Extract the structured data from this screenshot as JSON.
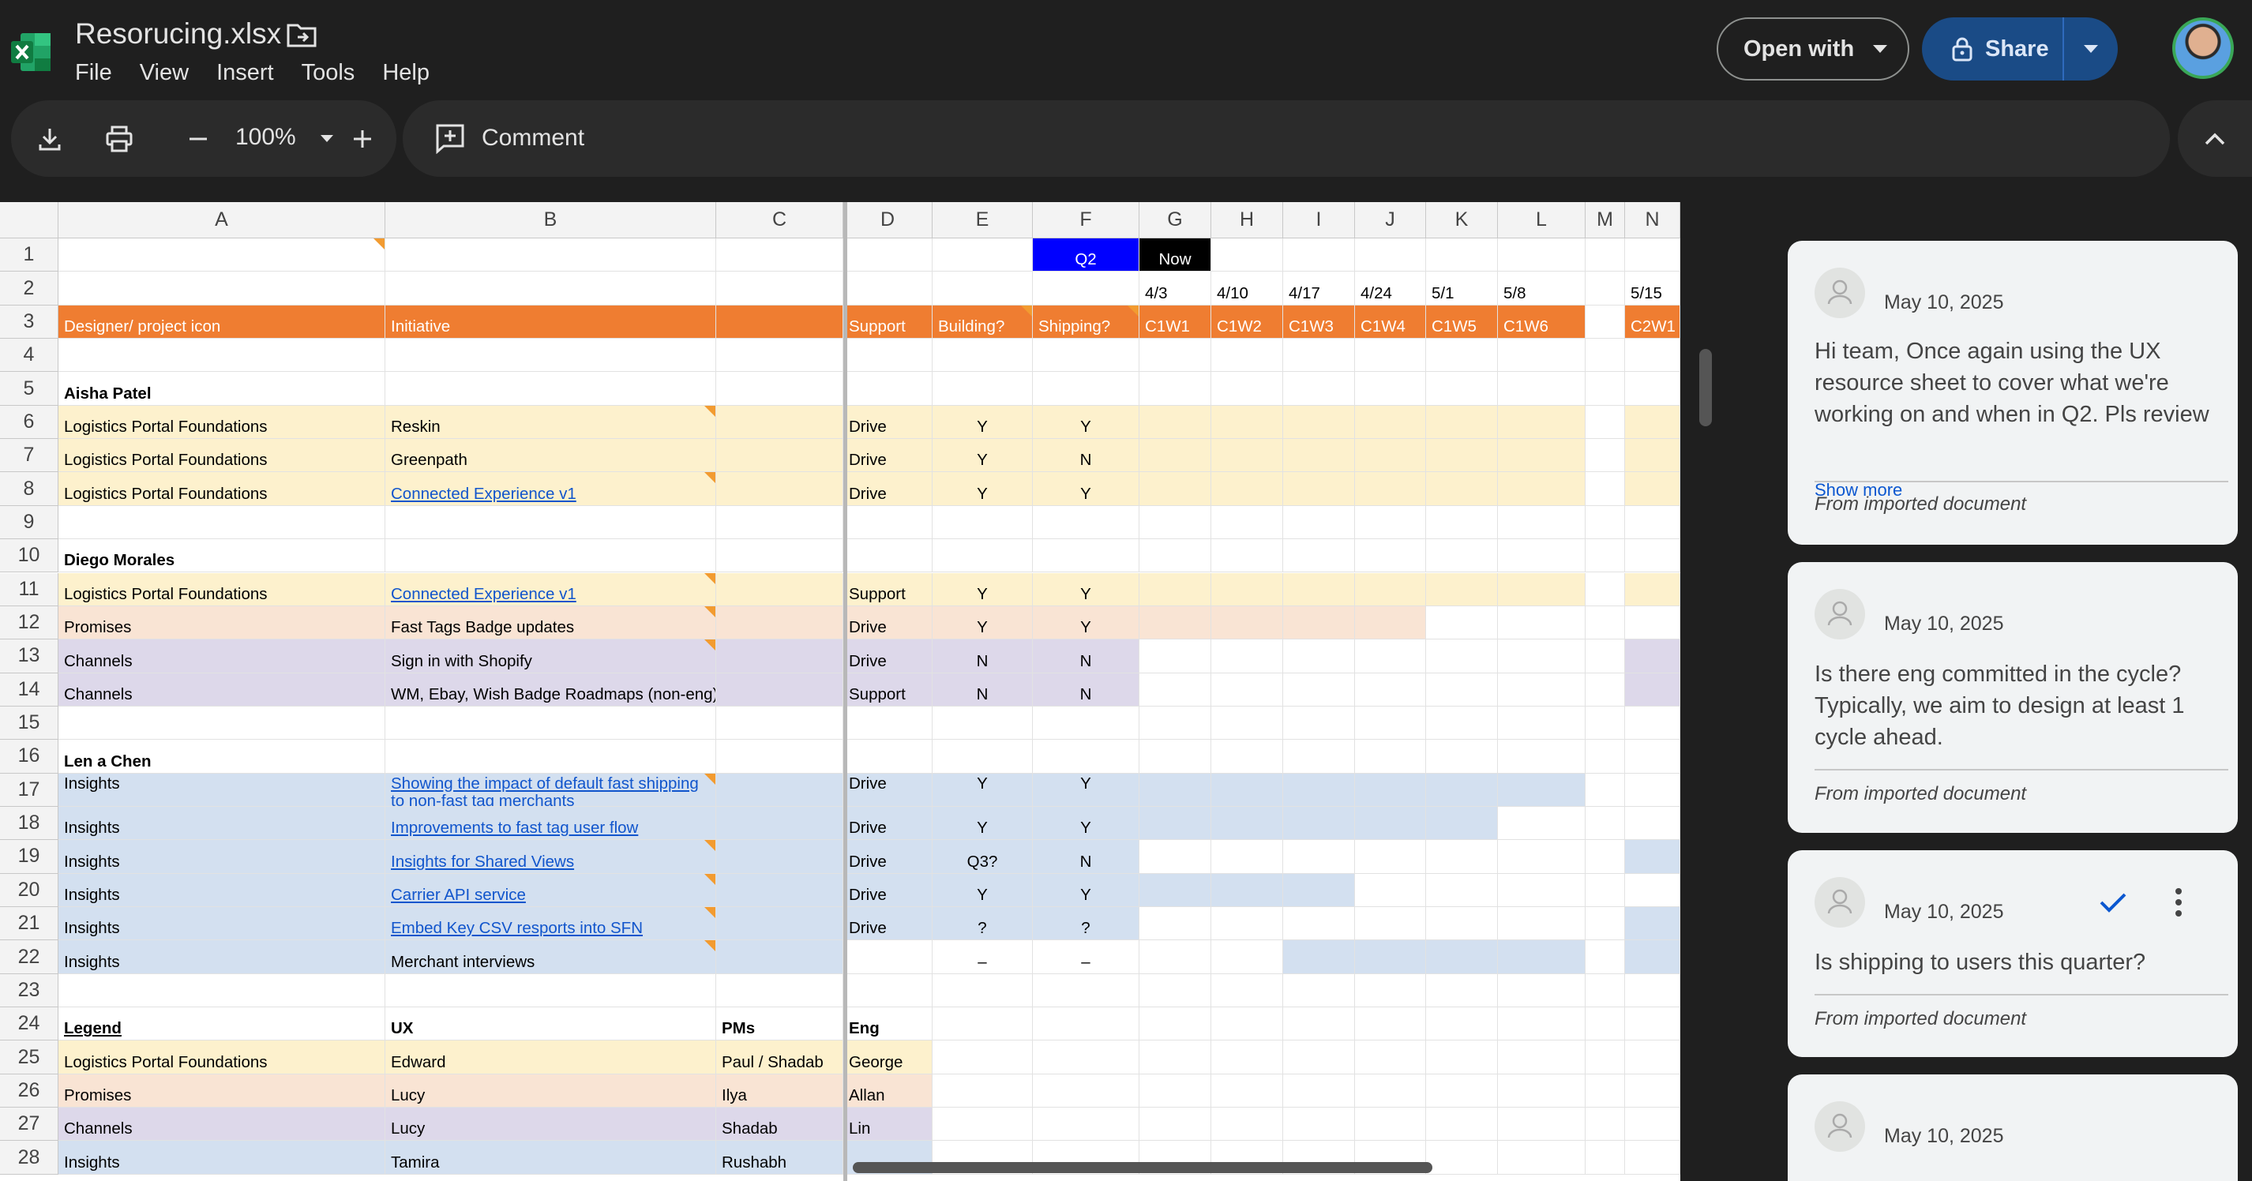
{
  "app": {
    "title": "Resorucing.xlsx",
    "menu": [
      "File",
      "View",
      "Insert",
      "Tools",
      "Help"
    ],
    "open_with_label": "Open with",
    "share_label": "Share"
  },
  "toolbar": {
    "zoom": "100%",
    "comment_label": "Comment"
  },
  "sheet": {
    "columns": [
      "A",
      "B",
      "C",
      "D",
      "E",
      "F",
      "G",
      "H",
      "I",
      "J",
      "K",
      "L",
      "M",
      "N"
    ],
    "rows": [
      {
        "n": 1,
        "cells": {
          "F": "Q2",
          "G": "Now"
        }
      },
      {
        "n": 2,
        "cells": {
          "G": "4/3",
          "H": "4/10",
          "I": "4/17",
          "J": "4/24",
          "K": "5/1",
          "L": "5/8",
          "N": "5/15"
        }
      },
      {
        "n": 3,
        "cells": {
          "A": "Designer/ project icon",
          "B": "Initiative",
          "D": "Support",
          "E": "Building?",
          "F": "Shipping?",
          "G": "C1W1",
          "H": "C1W2",
          "I": "C1W3",
          "J": "C1W4",
          "K": "C1W5",
          "L": "C1W6",
          "N": "C2W1"
        }
      },
      {
        "n": 4,
        "cells": {}
      },
      {
        "n": 5,
        "cells": {
          "A": "Aisha Patel"
        }
      },
      {
        "n": 6,
        "cells": {
          "A": "Logistics Portal Foundations",
          "B": "Reskin",
          "D": "Drive",
          "E": "Y",
          "F": "Y"
        }
      },
      {
        "n": 7,
        "cells": {
          "A": "Logistics Portal Foundations",
          "B": "Greenpath",
          "D": "Drive",
          "E": "Y",
          "F": "N"
        }
      },
      {
        "n": 8,
        "cells": {
          "A": "Logistics Portal Foundations",
          "B": "Connected Experience v1",
          "D": "Drive",
          "E": "Y",
          "F": "Y"
        }
      },
      {
        "n": 9,
        "cells": {}
      },
      {
        "n": 10,
        "cells": {
          "A": "Diego Morales"
        }
      },
      {
        "n": 11,
        "cells": {
          "A": "Logistics Portal Foundations",
          "B": "Connected Experience v1",
          "D": "Support",
          "E": "Y",
          "F": "Y"
        }
      },
      {
        "n": 12,
        "cells": {
          "A": "Promises",
          "B": "Fast Tags Badge updates",
          "D": "Drive",
          "E": "Y",
          "F": "Y"
        }
      },
      {
        "n": 13,
        "cells": {
          "A": "Channels",
          "B": "Sign in with Shopify",
          "D": "Drive",
          "E": "N",
          "F": "N"
        }
      },
      {
        "n": 14,
        "cells": {
          "A": "Channels",
          "B": "WM, Ebay, Wish Badge Roadmaps (non-eng)",
          "D": "Support",
          "E": "N",
          "F": "N"
        }
      },
      {
        "n": 15,
        "cells": {}
      },
      {
        "n": 16,
        "cells": {
          "A": "Len a Chen"
        }
      },
      {
        "n": 17,
        "cells": {
          "A": "Insights",
          "B": "Showing the impact of default fast shipping to non-fast tag merchants",
          "D": "Drive",
          "E": "Y",
          "F": "Y"
        }
      },
      {
        "n": 18,
        "cells": {
          "A": "Insights",
          "B": "Improvements to fast tag user flow",
          "D": "Drive",
          "E": "Y",
          "F": "Y"
        }
      },
      {
        "n": 19,
        "cells": {
          "A": "Insights",
          "B": "Insights for Shared Views",
          "D": "Drive",
          "E": "Q3?",
          "F": "N"
        }
      },
      {
        "n": 20,
        "cells": {
          "A": "Insights",
          "B": "Carrier API service",
          "D": "Drive",
          "E": "Y",
          "F": "Y"
        }
      },
      {
        "n": 21,
        "cells": {
          "A": "Insights",
          "B": "Embed Key CSV resports into SFN",
          "D": "Drive",
          "E": "?",
          "F": "?"
        }
      },
      {
        "n": 22,
        "cells": {
          "A": "Insights",
          "B": "Merchant interviews",
          "E": "–",
          "F": "–"
        }
      },
      {
        "n": 23,
        "cells": {}
      },
      {
        "n": 24,
        "cells": {
          "A": "Legend",
          "B": "UX",
          "C": "PMs",
          "D": "Eng"
        }
      },
      {
        "n": 25,
        "cells": {
          "A": "Logistics Portal Foundations",
          "B": "Edward",
          "C": "Paul / Shadab",
          "D": "George"
        }
      },
      {
        "n": 26,
        "cells": {
          "A": "Promises",
          "B": "Lucy",
          "C": "Ilya",
          "D": "Allan"
        }
      },
      {
        "n": 27,
        "cells": {
          "A": "Channels",
          "B": "Lucy",
          "C": "Shadab",
          "D": "Lin"
        }
      },
      {
        "n": 28,
        "cells": {
          "A": "Insights",
          "B": "Tamira",
          "C": "Rushabh",
          "D": ""
        }
      }
    ]
  },
  "colors": {
    "orange_header": "#ef7d31",
    "yellow": "#fdf1cd",
    "peach": "#f9e4d4",
    "purple": "#ddd8ea",
    "blue": "#d3e0f0",
    "q2_blue": "#0000ff",
    "now_black": "#000000"
  },
  "comments": [
    {
      "date": "May 10, 2025",
      "text": "Hi team, Once again using the UX resource sheet to cover what we're working on and when in Q2. Pls review",
      "more": "Show more",
      "source": "From imported document"
    },
    {
      "date": "May 10, 2025",
      "text": "Is there eng committed in the cycle? Typically, we aim to design at least 1 cycle ahead.",
      "source": "From imported document"
    },
    {
      "date": "May 10, 2025",
      "text": "Is shipping to users this quarter?",
      "source": "From imported document"
    },
    {
      "date": "May 10, 2025",
      "text": ""
    }
  ]
}
